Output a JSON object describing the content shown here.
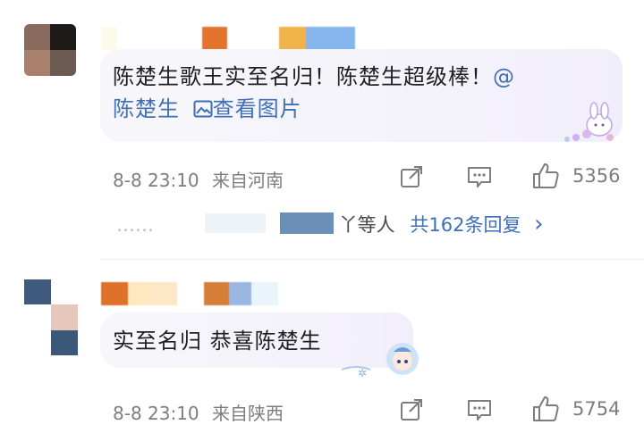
{
  "comments": [
    {
      "text_main": "陈楚生歌王实至名归！陈楚生超级棒！",
      "mention_at": "@",
      "mention_name": "陈楚生",
      "view_image": "查看图片",
      "timestamp": "8-8 23:10",
      "location": "来自河南",
      "like_count": "5356",
      "replies": {
        "ellipsis": "……",
        "suffix": "丫等人",
        "total": "共162条回复",
        "chevron": "›"
      }
    },
    {
      "text": "实至名归 恭喜陈楚生",
      "timestamp": "8-8 23:10",
      "location": "来自陕西",
      "like_count": "5754"
    }
  ],
  "colors": {
    "link_blue": "#3f6fb6",
    "meta_gray": "#7d7d7d",
    "bubble_bg": "#f5f3fb"
  },
  "icons": [
    "share-icon",
    "comment-icon",
    "like-icon",
    "image-icon",
    "chevron-right-icon"
  ]
}
